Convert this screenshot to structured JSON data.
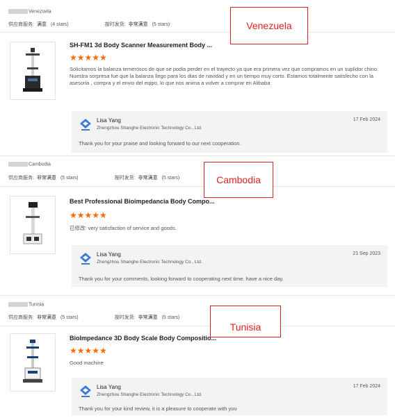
{
  "labels": {
    "supplier_service": "供应商服务:",
    "on_time_shipping": "按时发货:"
  },
  "reviews": [
    {
      "buyer_country": "Venezuela",
      "supplier_service_value": "满意",
      "supplier_service_stars": "(4 stars)",
      "shipping_value": "非常满意",
      "shipping_stars": "(5 stars)",
      "product_title": "SH-FM1 3d Body Scanner Measurement Body ...",
      "stars": "★★★★★",
      "text": "Solicitamos la balanza temerosos de que se podia perder en el trayecto ya que era primera vez que compramos en un suplidor chino.\nNuestra sorpresa fue que la balanza llego para los dias de navidad y en un tiempo muy corto. Estamos totalmente satisfecho con la asesoria , compra y el envio del eqipo, lo que nos anima a volver a comprar en Alibaba",
      "reply_name": "Lisa Yang",
      "reply_company": "Zhengzhou Shanghe Electronic Technology Co., Ltd.",
      "reply_date": "17 Feb 2024",
      "reply_text": "Thank you for your praise and looking forward to our next cooperation.",
      "country_tag": "Venezuela"
    },
    {
      "buyer_country": "Cambodia",
      "supplier_service_value": "非常满意",
      "supplier_service_stars": "(5 stars)",
      "shipping_value": "非常满意",
      "shipping_stars": "(5 stars)",
      "product_title": "Best Professional Bioimpedancia Body Compo...",
      "stars": "★★★★★",
      "text": "已修改: very satisfaction of service and goods.",
      "reply_name": "Lisa Yang",
      "reply_company": "Zhengzhou Shanghe Electronic Technology Co., Ltd.",
      "reply_date": "21 Sep 2023",
      "reply_text": "Thank you for your comments, looking forward to cooperating next time. have a nice day.",
      "country_tag": "Cambodia"
    },
    {
      "buyer_country": "Tunisia",
      "supplier_service_value": "非常满意",
      "supplier_service_stars": "(5 stars)",
      "shipping_value": "非常满意",
      "shipping_stars": "(5 stars)",
      "product_title": "BioImpedance 3D Body Scale Body Compositio...",
      "stars": "★★★★★",
      "text": "Good machine",
      "reply_name": "Lisa Yang",
      "reply_company": "Zhengzhou Shanghe Electronic Technology Co., Ltd.",
      "reply_date": "17 Feb 2024",
      "reply_text": "Thank you for your kind review, it is a pleasure to cooperate with you",
      "country_tag": "Tunisia"
    }
  ]
}
